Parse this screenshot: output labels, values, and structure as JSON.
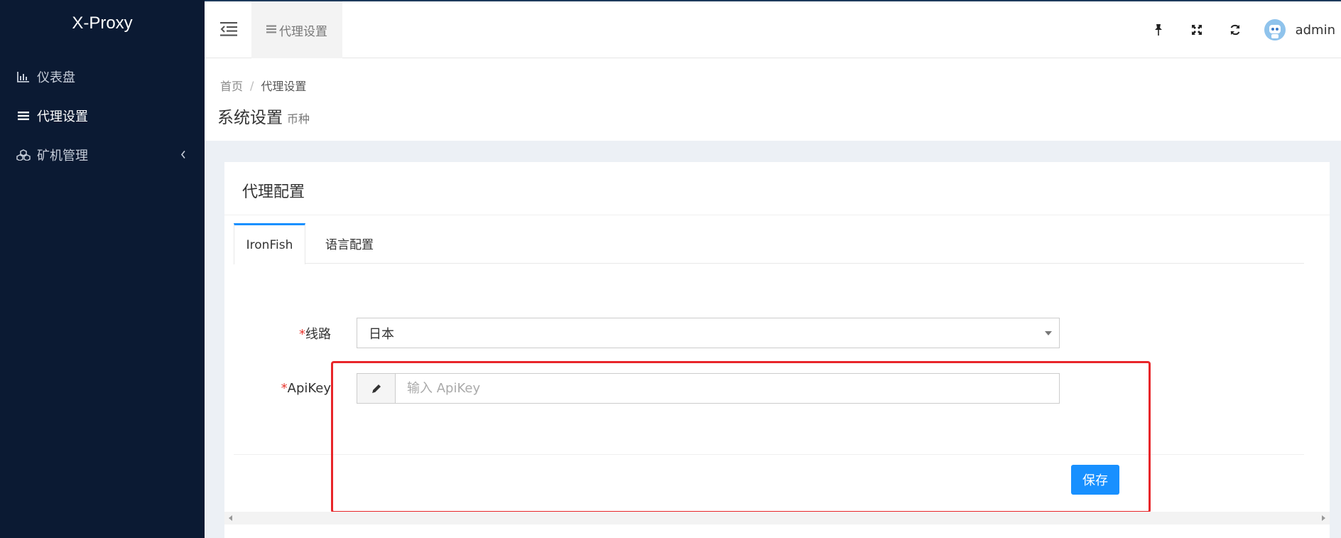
{
  "app": {
    "title": "X-Proxy"
  },
  "sidebar": {
    "items": [
      {
        "label": "仪表盘",
        "icon": "bar-chart-icon"
      },
      {
        "label": "代理设置",
        "icon": "menu-lines-icon"
      },
      {
        "label": "矿机管理",
        "icon": "cubes-icon"
      }
    ]
  },
  "topbar": {
    "tab_label": "代理设置",
    "user": "admin"
  },
  "breadcrumb": {
    "home": "首页",
    "sep": "/",
    "current": "代理设置"
  },
  "page": {
    "title": "系统设置",
    "subtitle": "币种"
  },
  "panel": {
    "title": "代理配置",
    "tabs": [
      {
        "label": "IronFish"
      },
      {
        "label": "语言配置"
      }
    ]
  },
  "form": {
    "required_mark": "*",
    "route_label": "线路",
    "route_value": "日本",
    "apikey_label": "ApiKey",
    "apikey_value": "",
    "apikey_placeholder": "输入 ApiKey",
    "save_label": "保存"
  },
  "colors": {
    "sidebar_bg": "#0b1a33",
    "accent": "#1890ff",
    "highlight": "#e8262a"
  }
}
